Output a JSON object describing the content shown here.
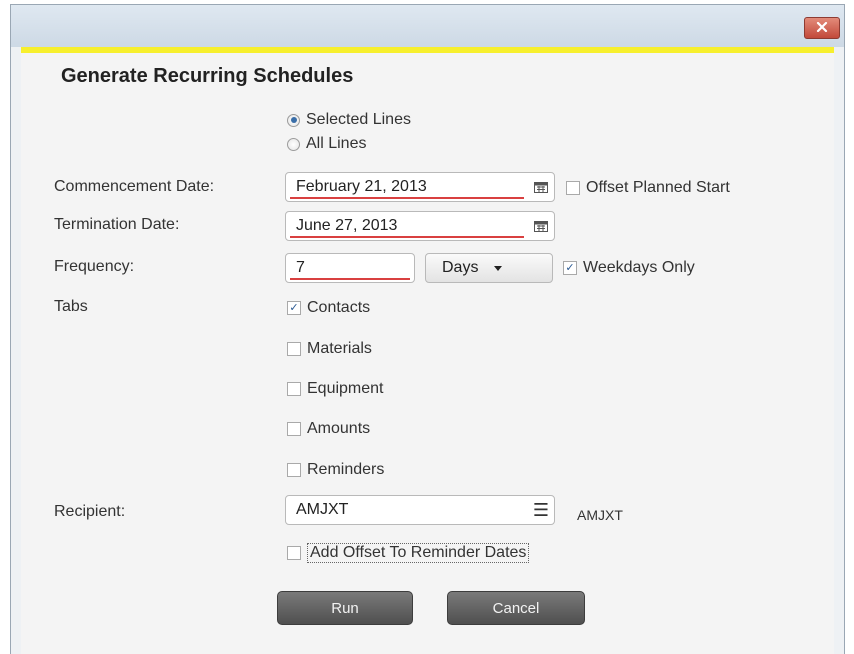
{
  "window": {
    "close_icon": "close-icon",
    "accent_color": "#f7ef2d",
    "close_color": "#c2493a"
  },
  "dialog": {
    "title": "Generate Recurring Schedules"
  },
  "scope": {
    "options": [
      {
        "label": "Selected Lines",
        "selected": true
      },
      {
        "label": "All Lines",
        "selected": false
      }
    ]
  },
  "commencement": {
    "label": "Commencement Date:",
    "value": "February 21, 2013",
    "offset_label": "Offset Planned Start",
    "offset_checked": false
  },
  "termination": {
    "label": "Termination Date:",
    "value": "June 27, 2013"
  },
  "frequency": {
    "label": "Frequency:",
    "value": "7",
    "unit": "Days",
    "weekdays_label": "Weekdays Only",
    "weekdays_checked": true
  },
  "tabs": {
    "label": "Tabs",
    "items": [
      {
        "label": "Contacts",
        "checked": true
      },
      {
        "label": "Materials",
        "checked": false
      },
      {
        "label": "Equipment",
        "checked": false
      },
      {
        "label": "Amounts",
        "checked": false
      },
      {
        "label": "Reminders",
        "checked": false
      }
    ]
  },
  "recipient": {
    "label": "Recipient:",
    "value": "AMJXT",
    "display": "AMJXT",
    "menu_icon": "list-icon"
  },
  "reminder_offset": {
    "label": "Add Offset To Reminder Dates",
    "checked": false
  },
  "buttons": {
    "run": "Run",
    "cancel": "Cancel"
  }
}
